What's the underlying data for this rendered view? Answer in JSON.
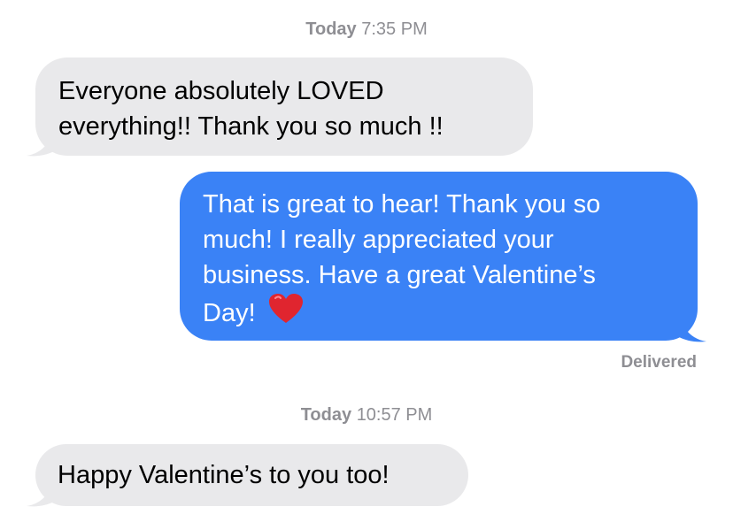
{
  "thread": {
    "timestamp1": {
      "day": "Today",
      "time": "7:35 PM"
    },
    "message1": {
      "line1": "Everyone absolutely LOVED",
      "line2": "everything!! Thank you so much !!"
    },
    "message2": {
      "line1": "That is great to hear! Thank you so",
      "line2": "much! I really appreciated your",
      "line3": "business. Have a great Valentine’s",
      "line4": "Day!",
      "emoji": "red-heart"
    },
    "status": "Delivered",
    "timestamp2": {
      "day": "Today",
      "time": "10:57 PM"
    },
    "message3": {
      "line1": "Happy Valentine’s to you too!"
    }
  },
  "colors": {
    "incoming_bubble": "#e9e9eb",
    "outgoing_bubble": "#3a82f6",
    "meta_text": "#8e8e93"
  }
}
